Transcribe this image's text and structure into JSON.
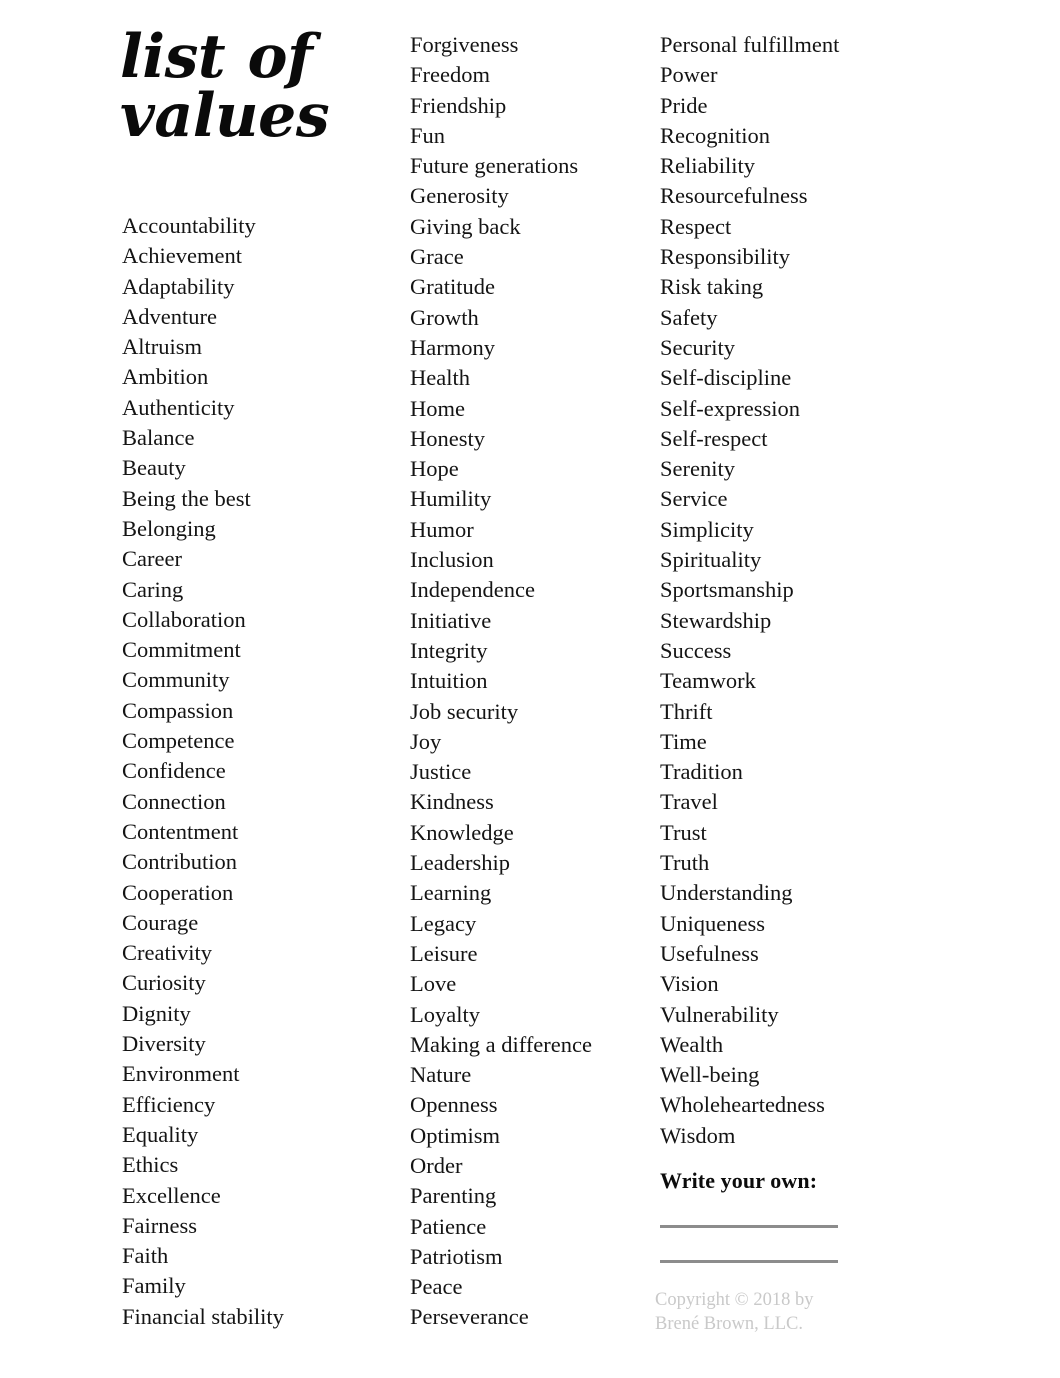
{
  "page": {
    "background_color": "#ffffff",
    "text_color": "#141414"
  },
  "title": {
    "line1": "list of",
    "line2": "values",
    "full": "list of values"
  },
  "columns": [
    {
      "name": "column-1",
      "items": [
        "Accountability",
        "Achievement",
        "Adaptability",
        "Adventure",
        "Altruism",
        "Ambition",
        "Authenticity",
        "Balance",
        "Beauty",
        "Being the best",
        "Belonging",
        "Career",
        "Caring",
        "Collaboration",
        "Commitment",
        "Community",
        "Compassion",
        "Competence",
        "Confidence",
        "Connection",
        "Contentment",
        "Contribution",
        "Cooperation",
        "Courage",
        "Creativity",
        "Curiosity",
        "Dignity",
        "Diversity",
        "Environment",
        "Efficiency",
        "Equality",
        "Ethics",
        "Excellence",
        "Fairness",
        "Faith",
        "Family",
        "Financial stability"
      ]
    },
    {
      "name": "column-2",
      "items": [
        "Forgiveness",
        "Freedom",
        "Friendship",
        "Fun",
        "Future generations",
        "Generosity",
        "Giving back",
        "Grace",
        "Gratitude",
        "Growth",
        "Harmony",
        "Health",
        "Home",
        "Honesty",
        "Hope",
        "Humility",
        "Humor",
        "Inclusion",
        "Independence",
        "Initiative",
        "Integrity",
        "Intuition",
        "Job security",
        "Joy",
        "Justice",
        "Kindness",
        "Knowledge",
        "Leadership",
        "Learning",
        "Legacy",
        "Leisure",
        "Love",
        "Loyalty",
        "Making a difference",
        "Nature",
        "Openness",
        "Optimism",
        "Order",
        "Parenting",
        "Patience",
        "Patriotism",
        "Peace",
        "Perseverance"
      ]
    },
    {
      "name": "column-3",
      "items": [
        "Personal fulfillment",
        "Power",
        "Pride",
        "Recognition",
        "Reliability",
        "Resourcefulness",
        "Respect",
        "Responsibility",
        "Risk taking",
        "Safety",
        "Security",
        "Self-discipline",
        "Self-expression",
        "Self-respect",
        "Serenity",
        "Service",
        "Simplicity",
        "Spirituality",
        "Sportsmanship",
        "Stewardship",
        "Success",
        "Teamwork",
        "Thrift",
        "Time",
        "Tradition",
        "Travel",
        "Trust",
        "Truth",
        "Understanding",
        "Uniqueness",
        "Usefulness",
        "Vision",
        "Vulnerability",
        "Wealth",
        "Well-being",
        "Wholeheartedness",
        "Wisdom"
      ]
    }
  ],
  "write_your_own": {
    "heading": "Write your own:",
    "blank_lines": 2,
    "rule_color": "#8c8c8c"
  },
  "copyright": {
    "line1": "Copyright © 2018 by",
    "line2": "Brené Brown, LLC.",
    "color": "#c9c9c9"
  }
}
